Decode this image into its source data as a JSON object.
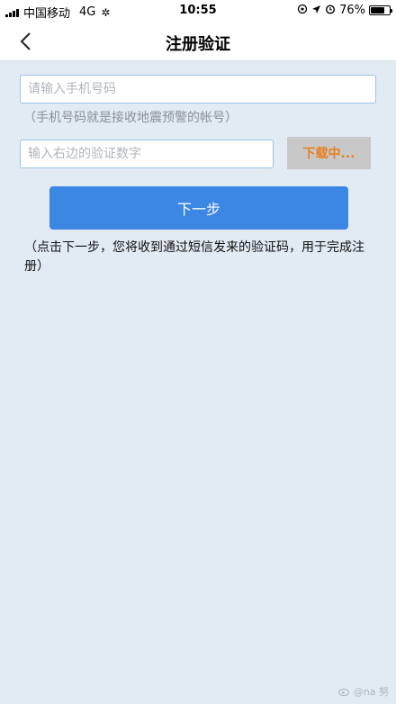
{
  "status_bar": {
    "carrier": "中国移动",
    "network": "4G",
    "busy_glyph": "✲",
    "time": "10:55",
    "battery_pct": "76%",
    "battery_level": 0.76,
    "icons": [
      "orientation-lock-icon",
      "location-icon",
      "alarm-icon"
    ]
  },
  "nav": {
    "title": "注册验证",
    "back_icon": "chevron-left-icon"
  },
  "form": {
    "phone_placeholder": "请输入手机号码",
    "phone_value": "",
    "phone_hint": "（手机号码就是接收地震预警的帐号）",
    "code_placeholder": "输入右边的验证数字",
    "code_value": "",
    "captcha_label": "下载中...",
    "next_label": "下一步",
    "notice": "（点击下一步，您将收到通过短信发来的验证码，用于完成注册）"
  },
  "watermark": {
    "text": "@na 努"
  },
  "colors": {
    "background": "#e2eaf3",
    "primary": "#3c86e4",
    "captcha_text": "#e8801e",
    "input_border": "#9cc3ea"
  }
}
